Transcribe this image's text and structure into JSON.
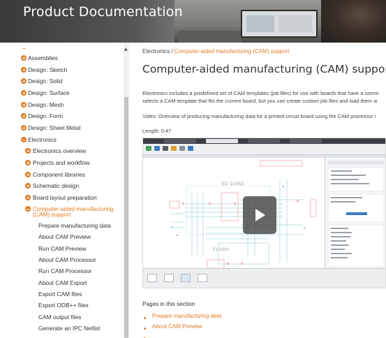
{
  "banner": {
    "title": "Product Documentation"
  },
  "sidebar": {
    "items": [
      {
        "label": "Assemblies",
        "icon": "plus-circle-icon",
        "level": 0
      },
      {
        "label": "Design: Sketch",
        "icon": "plus-circle-icon",
        "level": 0
      },
      {
        "label": "Design: Solid",
        "icon": "plus-circle-icon",
        "level": 0
      },
      {
        "label": "Design: Surface",
        "icon": "plus-circle-icon",
        "level": 0
      },
      {
        "label": "Design: Mesh",
        "icon": "plus-circle-icon",
        "level": 0
      },
      {
        "label": "Design: Form",
        "icon": "plus-circle-icon",
        "level": 0
      },
      {
        "label": "Design: Sheet Metal",
        "icon": "plus-circle-icon",
        "level": 0
      },
      {
        "label": "Electronics",
        "icon": "minus-circle-icon",
        "level": 0
      },
      {
        "label": "Electronics overview",
        "icon": "plus-circle-icon",
        "level": 1
      },
      {
        "label": "Projects and workflow",
        "icon": "plus-circle-icon",
        "level": 1
      },
      {
        "label": "Component libraries",
        "icon": "plus-circle-icon",
        "level": 1
      },
      {
        "label": "Schematic design",
        "icon": "plus-circle-icon",
        "level": 1
      },
      {
        "label": "Board layout preparation",
        "icon": "plus-circle-icon",
        "level": 1
      },
      {
        "label_line1": "Computer-aided manufacturing",
        "label_line2": "(CAM) support",
        "icon": "minus-circle-icon",
        "level": 1,
        "active": true
      },
      {
        "label": "Prepare manufacturing data",
        "level": 2
      },
      {
        "label": "About CAM Preview",
        "level": 2
      },
      {
        "label": "Run CAM Preview",
        "level": 2
      },
      {
        "label": "About CAM Processor",
        "level": 2
      },
      {
        "label": "Run CAM Processor",
        "level": 2
      },
      {
        "label": "About CAM Export",
        "level": 2
      },
      {
        "label": "Export CAM files",
        "level": 2
      },
      {
        "label": "Export ODB++ files",
        "level": 2
      },
      {
        "label": "CAM output files",
        "level": 2
      },
      {
        "label": "Generate an IPC Netlist",
        "level": 2
      }
    ]
  },
  "breadcrumb": {
    "root": "Electronics",
    "separator": " / ",
    "current": "Computer-aided manufacturing (CAM) support"
  },
  "page": {
    "title": "Computer-aided manufacturing (CAM) support",
    "intro_line1": "Electronics includes a predefined set of CAM templates (job files) for use with boards that have a comm",
    "intro_line2": "selects a CAM template that fits the current board, but you can create custom job files and load them w",
    "video_caption": "Video: Overview of producing manufacturing data for a printed circuit board using the CAM processor i",
    "length": "Length: 0:47"
  },
  "video": {
    "label_sdcard": "SD CARD",
    "label_flash": "FLASH",
    "play_label": "play-icon"
  },
  "section": {
    "heading": "Pages in this section",
    "links": [
      "Prepare manufacturing data",
      "About CAM Preview"
    ]
  },
  "colors": {
    "accent": "#e07b1f",
    "text": "#333333"
  }
}
